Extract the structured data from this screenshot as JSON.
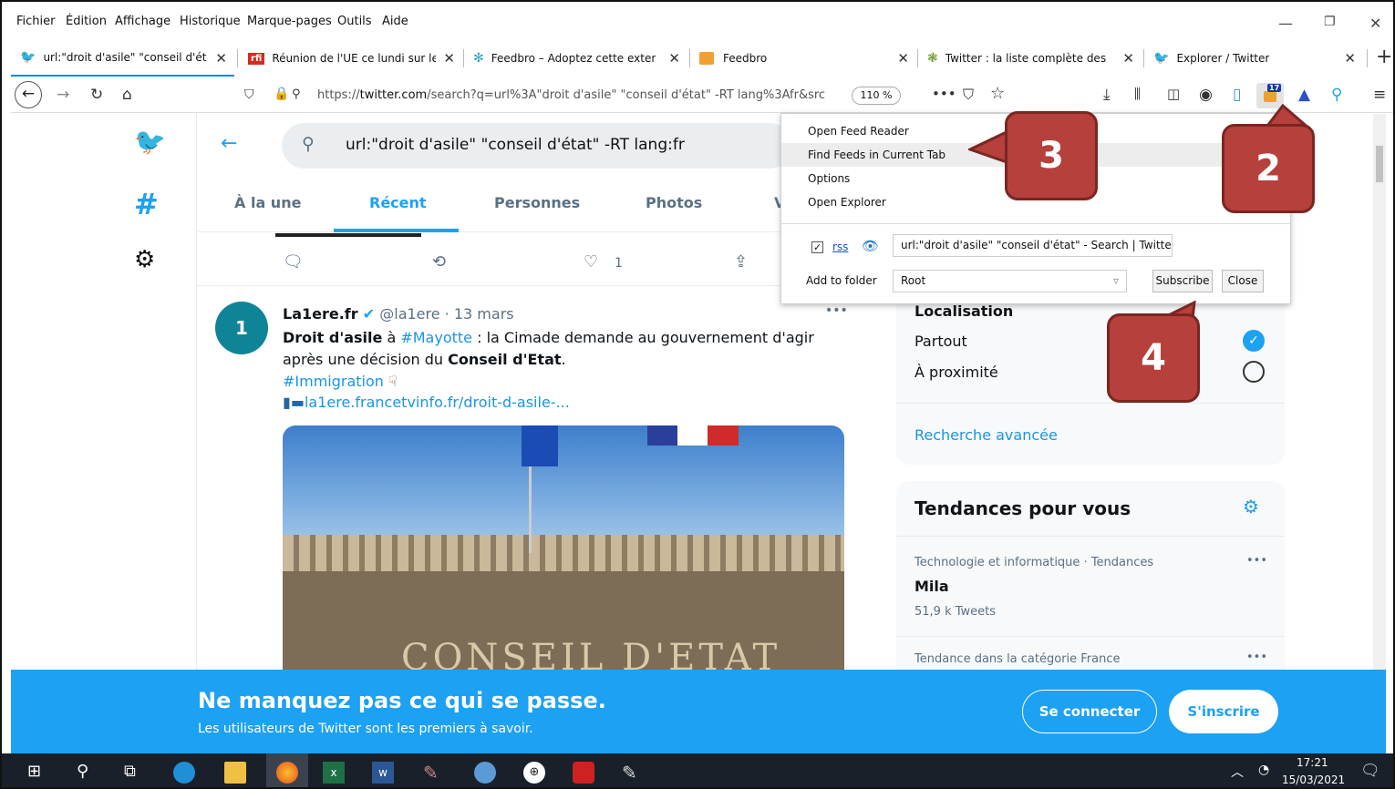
{
  "menubar": {
    "items": [
      "Fichier",
      "Édition",
      "Affichage",
      "Historique",
      "Marque-pages",
      "Outils",
      "Aide"
    ]
  },
  "tabs": [
    {
      "label": "url:\"droit d'asile\" \"conseil d'éta",
      "icon": "twitter-bird-icon"
    },
    {
      "label": "Réunion de l'UE ce lundi sur le",
      "icon": "rfi-logo-icon"
    },
    {
      "label": "Feedbro – Adoptez cette exten",
      "icon": "feedbro-icon"
    },
    {
      "label": "Feedbro",
      "icon": "feedbro-icon"
    },
    {
      "label": "Twitter : la liste complète des o",
      "icon": "globe-icon"
    },
    {
      "label": "Explorer / Twitter",
      "icon": "twitter-bird-icon"
    }
  ],
  "url": {
    "prefix": "https://",
    "domain": "twitter.com",
    "rest": "/search?q=url%3A\"droit d'asile\" \"conseil d'état\" -RT lang%3Afr&src",
    "zoom": "110 %"
  },
  "addon_badge": "17",
  "twitter": {
    "search_query": "url:\"droit d'asile\" \"conseil d'état\" -RT lang:fr",
    "tabs": [
      "À la une",
      "Récent",
      "Personnes",
      "Photos",
      "V"
    ],
    "like_count": "1",
    "tweet": {
      "avatar_text": "1",
      "author": "La1ere.fr",
      "handle_date": "@la1ere · 13 mars",
      "line1_bold": "Droit d'asile",
      "line1_mid": " à ",
      "line1_tag": "#Mayotte",
      "line1_rest": " : la Cimade demande au gouvernement d'agir",
      "line2_pre": "après une décision du ",
      "line2_bold": "Conseil d'Etat",
      "line2_post": ".",
      "hashtag": "#Immigration",
      "link": "la1ere.francetvinfo.fr/droit-d-asile-...",
      "photo_text": "CONSEIL D'ETAT"
    },
    "location": {
      "title": "Localisation",
      "options": [
        "Partout",
        "À proximité"
      ],
      "advanced": "Recherche avancée"
    },
    "trends": {
      "title": "Tendances pour vous",
      "items": [
        {
          "context": "Technologie et informatique · Tendances",
          "name": "Mila",
          "count": "51,9 k Tweets"
        },
        {
          "context": "Tendance dans la catégorie France"
        }
      ]
    },
    "banner": {
      "title": "Ne manquez pas ce qui se passe.",
      "subtitle": "Les utilisateurs de Twitter sont les premiers à savoir.",
      "login": "Se connecter",
      "signup": "S'inscrire"
    }
  },
  "feedbro_popup": {
    "menu": [
      "Open Feed Reader",
      "Find Feeds in Current Tab",
      "Options",
      "Open Explorer"
    ],
    "rss_label": "rss",
    "feed_title": "url:\"droit d'asile\" \"conseil d'état\" - Search | Twitter",
    "folder_label": "Add to folder",
    "folder_value": "Root",
    "subscribe": "Subscribe",
    "close": "Close"
  },
  "callouts": [
    "3",
    "2",
    "4"
  ],
  "taskbar": {
    "time": "17:21",
    "date": "15/03/2021"
  },
  "colors": {
    "twitter_blue": "#1da1f2",
    "callout_red": "#b5403c",
    "taskbar": "#1a2029"
  }
}
